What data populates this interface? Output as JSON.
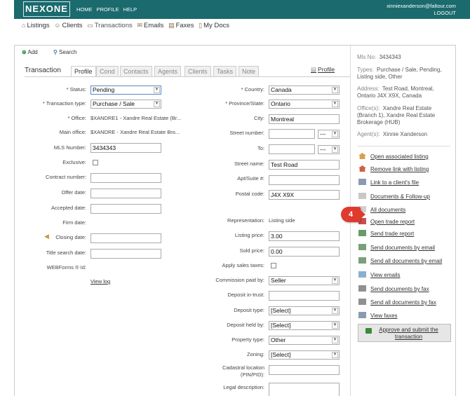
{
  "header": {
    "logo": "NEXONE",
    "nav": [
      "HOME",
      "PROFILE",
      "HELP"
    ],
    "user_email": "xinniexanderson@faltour.com",
    "logout": "LOGOUT",
    "bg_color": "#1a6a6e"
  },
  "subnav": [
    {
      "label": "Listings",
      "icon": "house-icon"
    },
    {
      "label": "Clients",
      "icon": "person-icon"
    },
    {
      "label": "Transactions",
      "icon": "folder-icon"
    },
    {
      "label": "Emails",
      "icon": "envelope-icon"
    },
    {
      "label": "Faxes",
      "icon": "fax-icon"
    },
    {
      "label": "My Docs",
      "icon": "document-icon"
    }
  ],
  "toolbar": {
    "add": "Add",
    "search": "Search"
  },
  "tabs": {
    "title": "Transaction",
    "items": [
      "Profile",
      "Cond",
      "Contacts",
      "Agents",
      "Clients",
      "Tasks",
      "Note"
    ],
    "active": "Profile",
    "profile_link": "Profile"
  },
  "left_form": {
    "status": {
      "label": "* Status:",
      "value": "Pending"
    },
    "transaction_type": {
      "label": "* Transaction type:",
      "value": "Purchase / Sale"
    },
    "office": {
      "label": "* Office:",
      "value": "$XANDRE1 - Xandre Real Estate (Br..."
    },
    "main_office": {
      "label": "Main office:",
      "value": "$XANDRE - Xandre Real Estate Bro..."
    },
    "mls_number": {
      "label": "MLS Number:",
      "value": "3434343"
    },
    "exclusive": {
      "label": "Exclusive:"
    },
    "contract_number": {
      "label": "Contract number:",
      "value": ""
    },
    "offer_date": {
      "label": "Offer date:",
      "value": ""
    },
    "accepted_date": {
      "label": "Accepted date:",
      "value": ""
    },
    "firm_date": {
      "label": "Firm date:"
    },
    "closing_date": {
      "label": "Closing date:",
      "value": ""
    },
    "title_search_date": {
      "label": "Title search date:",
      "value": ""
    },
    "webforms_id": {
      "label": "WEBForms ® Id:"
    },
    "view_log": "View log"
  },
  "right_form": {
    "country": {
      "label": "* Country:",
      "value": "Canada"
    },
    "province": {
      "label": "* Province/State:",
      "value": "Ontario"
    },
    "city": {
      "label": "City:",
      "value": "Montreal"
    },
    "street_number": {
      "label": "Street number:",
      "value": "",
      "suffix": "---"
    },
    "to": {
      "label": "To:",
      "value": "",
      "suffix": "---"
    },
    "street_name": {
      "label": "Street name:",
      "value": "Test Road"
    },
    "apt": {
      "label": "Apt/Suite #:",
      "value": ""
    },
    "postal_code": {
      "label": "Postal code:",
      "value": "J4X X9X"
    },
    "representation": {
      "label": "Representation:",
      "value": "Listing side"
    },
    "listing_price": {
      "label": "Listing price:",
      "value": "3.00"
    },
    "sold_price": {
      "label": "Sold price:",
      "value": "0.00"
    },
    "apply_sales_taxes": {
      "label": "Apply sales taxes:"
    },
    "commission_paid_by": {
      "label": "Commission paid by:",
      "value": "Seller"
    },
    "deposit_in_trust": {
      "label": "Deposit in-trust:",
      "value": ""
    },
    "deposit_type": {
      "label": "Deposit type:",
      "value": "[Select]"
    },
    "deposit_held_by": {
      "label": "Deposit held by:",
      "value": "[Select]"
    },
    "property_type": {
      "label": "Property type:",
      "value": "Other"
    },
    "zoning": {
      "label": "Zoning:",
      "value": "[Select]"
    },
    "cadastral_line1": "Cadastral location",
    "cadastral_line2": "(PIN/PID):",
    "legal_description": {
      "label": "Legal description:"
    }
  },
  "sidebar": {
    "mls": {
      "label": "Mls No:",
      "value": "3434343"
    },
    "types": {
      "label": "Types:",
      "value": "Purchase / Sale, Pending,",
      "value2": "Listing side, Other"
    },
    "address": {
      "label": "Address:",
      "value": "Test Road, Montreal,",
      "value2": "Ontario J4X X9X, Canada"
    },
    "offices": {
      "label": "Office(s):",
      "value": "Xandre Real Estate",
      "value2": "(Branch 1), Xandre Real Estate",
      "value3": "Brokerage (HUB)"
    },
    "agents": {
      "label": "Agent(s):",
      "value": "Xinnie Xanderson"
    },
    "actions": [
      {
        "label": "Open associated listing",
        "icon": "house-icon"
      },
      {
        "label": "Remove link with listing",
        "icon": "house-remove-icon"
      },
      {
        "label": "Link to a client's file",
        "icon": "client-file-icon"
      },
      {
        "label": "Documents",
        "label2": "Follow-up",
        "icon": "documents-icon"
      },
      {
        "label": "All documents",
        "icon": "all-documents-icon"
      },
      {
        "label": "Open trade report",
        "icon": "trade-report-icon"
      },
      {
        "label": "Send trade report",
        "icon": "send-report-icon"
      },
      {
        "label": "Send documents by email",
        "icon": "email-docs-icon"
      },
      {
        "label": "Send all documents by email",
        "icon": "email-all-icon"
      },
      {
        "label": "View emails",
        "icon": "view-emails-icon"
      },
      {
        "label": "Send documents by fax",
        "icon": "fax-docs-icon"
      },
      {
        "label": "Send all documents by fax",
        "icon": "fax-all-icon"
      },
      {
        "label": "View faxes",
        "icon": "view-faxes-icon"
      }
    ],
    "submit": {
      "line1": "Approve and submit the",
      "line2": "transaction"
    },
    "amp": "&"
  },
  "callout": {
    "number": "4",
    "color": "#e03a2e"
  }
}
